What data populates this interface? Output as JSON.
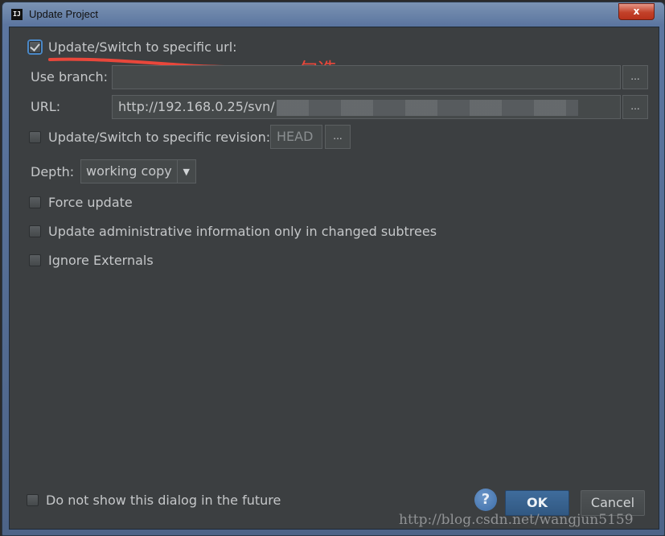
{
  "window": {
    "title": "Update Project",
    "app_icon_text": "IJ",
    "close_label": "x"
  },
  "options": {
    "switch_url": {
      "label": "Update/Switch to specific url:",
      "checked": true
    },
    "branch_label": "Use branch:",
    "branch_value": "",
    "url_label": "URL:",
    "url_value": "http://192.168.0.25/svn/",
    "switch_revision": {
      "label": "Update/Switch to specific revision:",
      "checked": false
    },
    "revision_value": "HEAD",
    "depth_label": "Depth:",
    "depth_value": "working copy",
    "force_update": {
      "label": "Force update",
      "checked": false
    },
    "admin_only": {
      "label": "Update administrative information only in changed subtrees",
      "checked": false
    },
    "ignore_externals": {
      "label": "Ignore Externals",
      "checked": false
    },
    "do_not_show": {
      "label": "Do not show this dialog in the future",
      "checked": false
    }
  },
  "browse_label": "...",
  "annotation": {
    "text": "勾选",
    "color": "#e8473b"
  },
  "buttons": {
    "help": "?",
    "ok": "OK",
    "cancel": "Cancel"
  },
  "watermark": "http://blog.csdn.net/wangjun5159",
  "colors": {
    "dialog_bg": "#3c3f41",
    "text": "#c5c7c9",
    "accent": "#4a88c7"
  }
}
